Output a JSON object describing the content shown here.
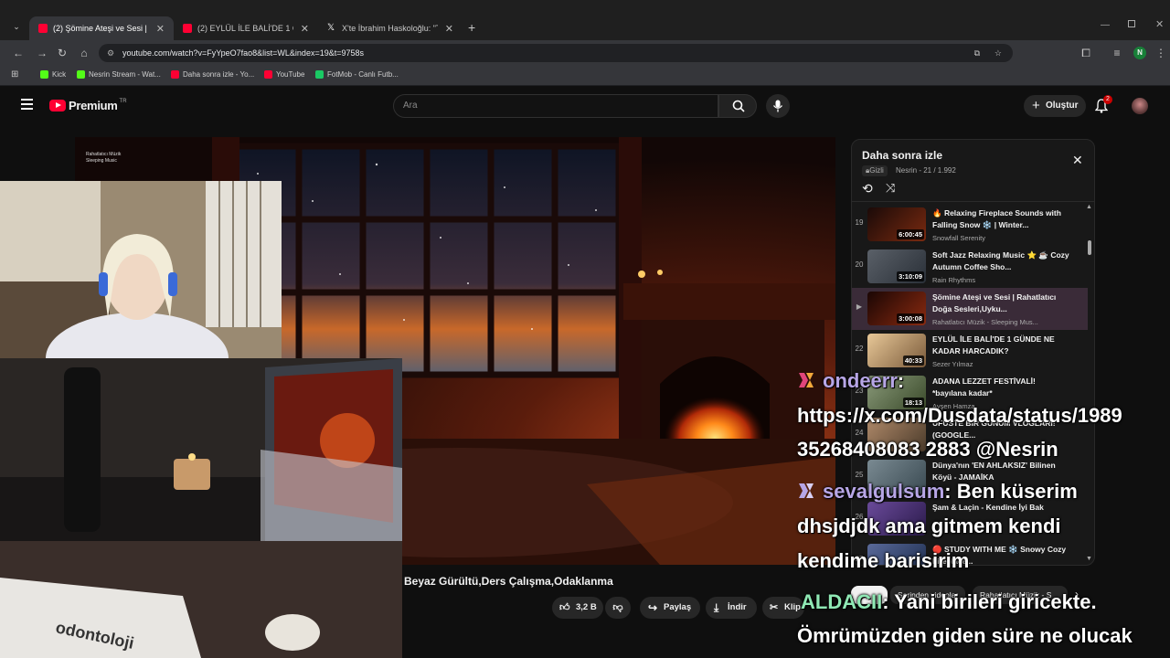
{
  "browser": {
    "tabs": [
      {
        "title": "(2) Şömine Ateşi ve Sesi | Rahatl",
        "color": "#ff0033"
      },
      {
        "title": "(2) EYLÜL İLE BALİ'DE 1 GÜNDE",
        "color": "#ff0033"
      },
      {
        "title": "X'te İbrahim Haskoloğlu: \"Türkiy",
        "color": "#ffffff"
      }
    ],
    "url": "youtube.com/watch?v=FyYpeO7fao8&list=WL&index=19&t=9758s",
    "bookmarks": [
      "Kick",
      "Nesrin Stream - Wat...",
      "Daha sonra izle - Yo...",
      "YouTube",
      "FotMob - Canlı Futb..."
    ],
    "profile_initial": "N"
  },
  "youtube": {
    "logo_text": "Premium",
    "logo_region": "TR",
    "search_placeholder": "Ara",
    "create_label": "Oluştur",
    "notification_count": "2"
  },
  "video": {
    "channel_watermark_line1": "Rahatlatıcı Müzik",
    "channel_watermark_line2": "Sleeping Music",
    "title_visible": "Beyaz Gürültü,Ders Çalışma,Odaklanma",
    "likes": "3,2 B",
    "share_label": "Paylaş",
    "download_label": "İndir",
    "clip_label": "Klip"
  },
  "playlist": {
    "title": "Daha sonra izle",
    "privacy": "Gizli",
    "owner_progress": "Nesrin - 21 / 1.992",
    "items": [
      {
        "index": "19",
        "duration": "6:00:45",
        "title": "🔥 Relaxing Fireplace Sounds with Falling Snow ❄️ | Winter...",
        "channel": "Snowfall Serenity",
        "thumb": "#3b2420"
      },
      {
        "index": "20",
        "duration": "3:10:09",
        "title": "Soft Jazz Relaxing Music ⭐ ☕ Cozy Autumn Coffee Sho...",
        "channel": "Rain Rhythms",
        "thumb": "#4a5058"
      },
      {
        "index": "▶",
        "duration": "3:00:08",
        "title": "Şömine Ateşi ve Sesi | Rahatlatıcı Doğa Sesleri,Uyku...",
        "channel": "Rahatlatıcı Müzik - Sleeping Mus...",
        "thumb": "#2a120c"
      },
      {
        "index": "22",
        "duration": "40:33",
        "title": "EYLÜL İLE BALİ'DE 1 GÜNDE NE KADAR HARCADIK?",
        "channel": "Sezer Yılmaz",
        "thumb": "#c59a6a"
      },
      {
        "index": "23",
        "duration": "18:13",
        "title": "ADANA LEZZET FESTİVALİ! *bayılana kadar*",
        "channel": "Ayşen Hamza",
        "thumb": "#6a7a5a"
      },
      {
        "index": "24",
        "duration": "",
        "title": "UFUSTE BİR GÜNÜM VLOGLARI! (GOOGLE...",
        "channel": "",
        "thumb": "#8a6a52"
      },
      {
        "index": "25",
        "duration": "",
        "title": "Dünya'nın 'EN AHLAKSIZ' Bilinen Köyü - JAMAİKA",
        "channel": "",
        "thumb": "#5a6a72"
      },
      {
        "index": "26",
        "duration": "",
        "title": "Şam & Laçin - Kendine İyi Bak",
        "channel": "",
        "thumb": "#4a3a6a"
      },
      {
        "index": "27",
        "duration": "",
        "title": "🔴 STUDY WITH ME ❄️ Snowy Cozy Fireplace...",
        "channel": "",
        "thumb": "#3a4a6a"
      }
    ]
  },
  "below": {
    "chip1": "Serinden videolar",
    "chip2": "Rahatlatıcı Müzik - S"
  },
  "chat": [
    {
      "user": "ondeerr",
      "text": ":",
      "cont": [
        "https://x.com/Dusdata/status/1989",
        "35268408083 2883 @Nesrin"
      ]
    },
    {
      "user": "sevalgulsum",
      "text": ": Ben küserim",
      "cont": [
        "dhsjdjdk ama gitmem kendi",
        "kendime barisirim"
      ]
    },
    {
      "user": "ALDACII",
      "text": ": Yani birileri giricekte.",
      "cont": [
        "Ömrümüzden giden süre ne olucak"
      ]
    }
  ]
}
